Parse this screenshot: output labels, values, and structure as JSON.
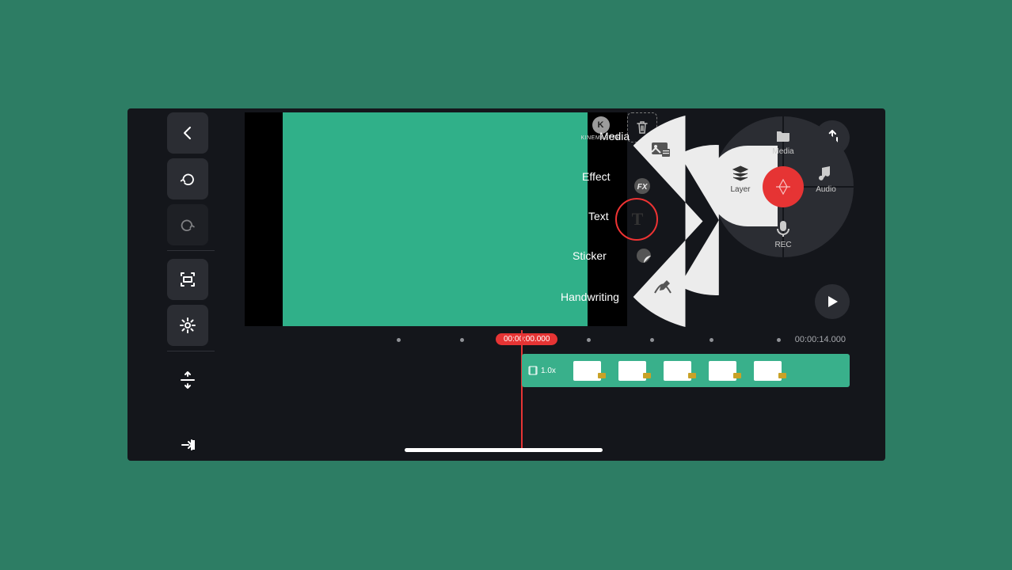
{
  "sidebar": {
    "back": "Back",
    "undo": "Undo",
    "redo": "Redo",
    "fit": "Fit to screen",
    "settings": "Settings",
    "split": "Split view",
    "jump_end": "Go to end"
  },
  "preview": {
    "watermark": "KINEMASTER",
    "watermark_k": "K"
  },
  "trash": "Delete",
  "wheel": {
    "media": "Media",
    "audio": "Audio",
    "layer": "Layer",
    "rec": "REC",
    "capture": "Capture"
  },
  "export": "Export",
  "play": "Play",
  "flyout": {
    "media": "Media",
    "effect": "Effect",
    "text": "Text",
    "sticker": "Sticker",
    "handwriting": "Handwriting"
  },
  "timeline": {
    "current": "00:00:00.000",
    "end": "00:00:14.000",
    "clip_speed": "1.0x"
  }
}
